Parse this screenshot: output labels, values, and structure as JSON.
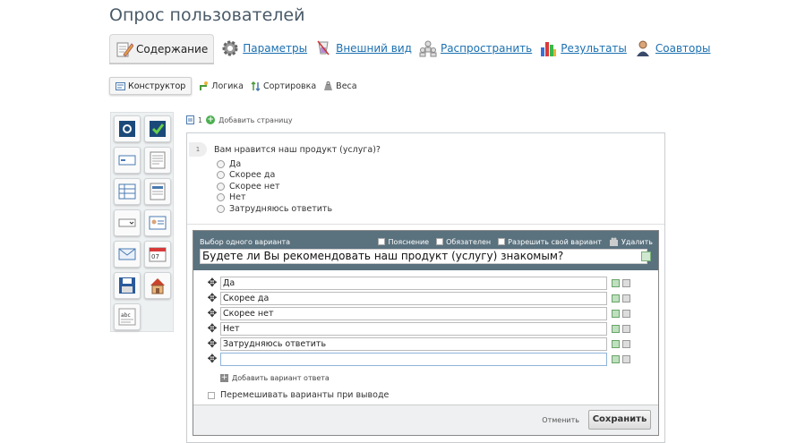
{
  "page": {
    "title": "Опрос пользователей"
  },
  "mainnav": {
    "content": "Содержание",
    "params": "Параметры",
    "appearance": "Внешний вид",
    "distribute": "Распространить",
    "results": "Результаты",
    "coauthors": "Соавторы"
  },
  "subnav": {
    "constructor": "Конструктор",
    "logic": "Логика",
    "sort": "Сортировка",
    "weights": "Веса"
  },
  "pagesel": {
    "page_number": "1",
    "add_page": "Добавить страницу"
  },
  "question": {
    "number": "1",
    "text": "Вам нравится наш продукт (услуга)?",
    "options": [
      "Да",
      "Скорее да",
      "Скорее нет",
      "Нет",
      "Затрудняюсь ответить"
    ]
  },
  "editor": {
    "type_label": "Выбор одного варианта",
    "explanation": "Пояснение",
    "required": "Обязателен",
    "allow_own": "Разрешить свой вариант",
    "delete": "Удалить",
    "question_text": "Будете ли Вы рекомендовать наш продукт (услугу) знакомым?",
    "answers": [
      "Да",
      "Скорее да",
      "Скорее нет",
      "Нет",
      "Затрудняюсь ответить",
      ""
    ],
    "add_answer": "Добавить вариант ответа",
    "shuffle": "Перемешивать варианты при выводе",
    "cancel": "Отменить",
    "save": "Сохранить"
  },
  "icons": {
    "content": "pencil-doc-icon",
    "params": "gear-icon",
    "appearance": "paint-icon",
    "distribute": "share-people-icon",
    "results": "bar-chart-icon",
    "coauthors": "user-icon"
  },
  "colors": {
    "link": "#1a6fb0",
    "editor_header": "#5a717e",
    "accent_green": "#4caf50"
  }
}
